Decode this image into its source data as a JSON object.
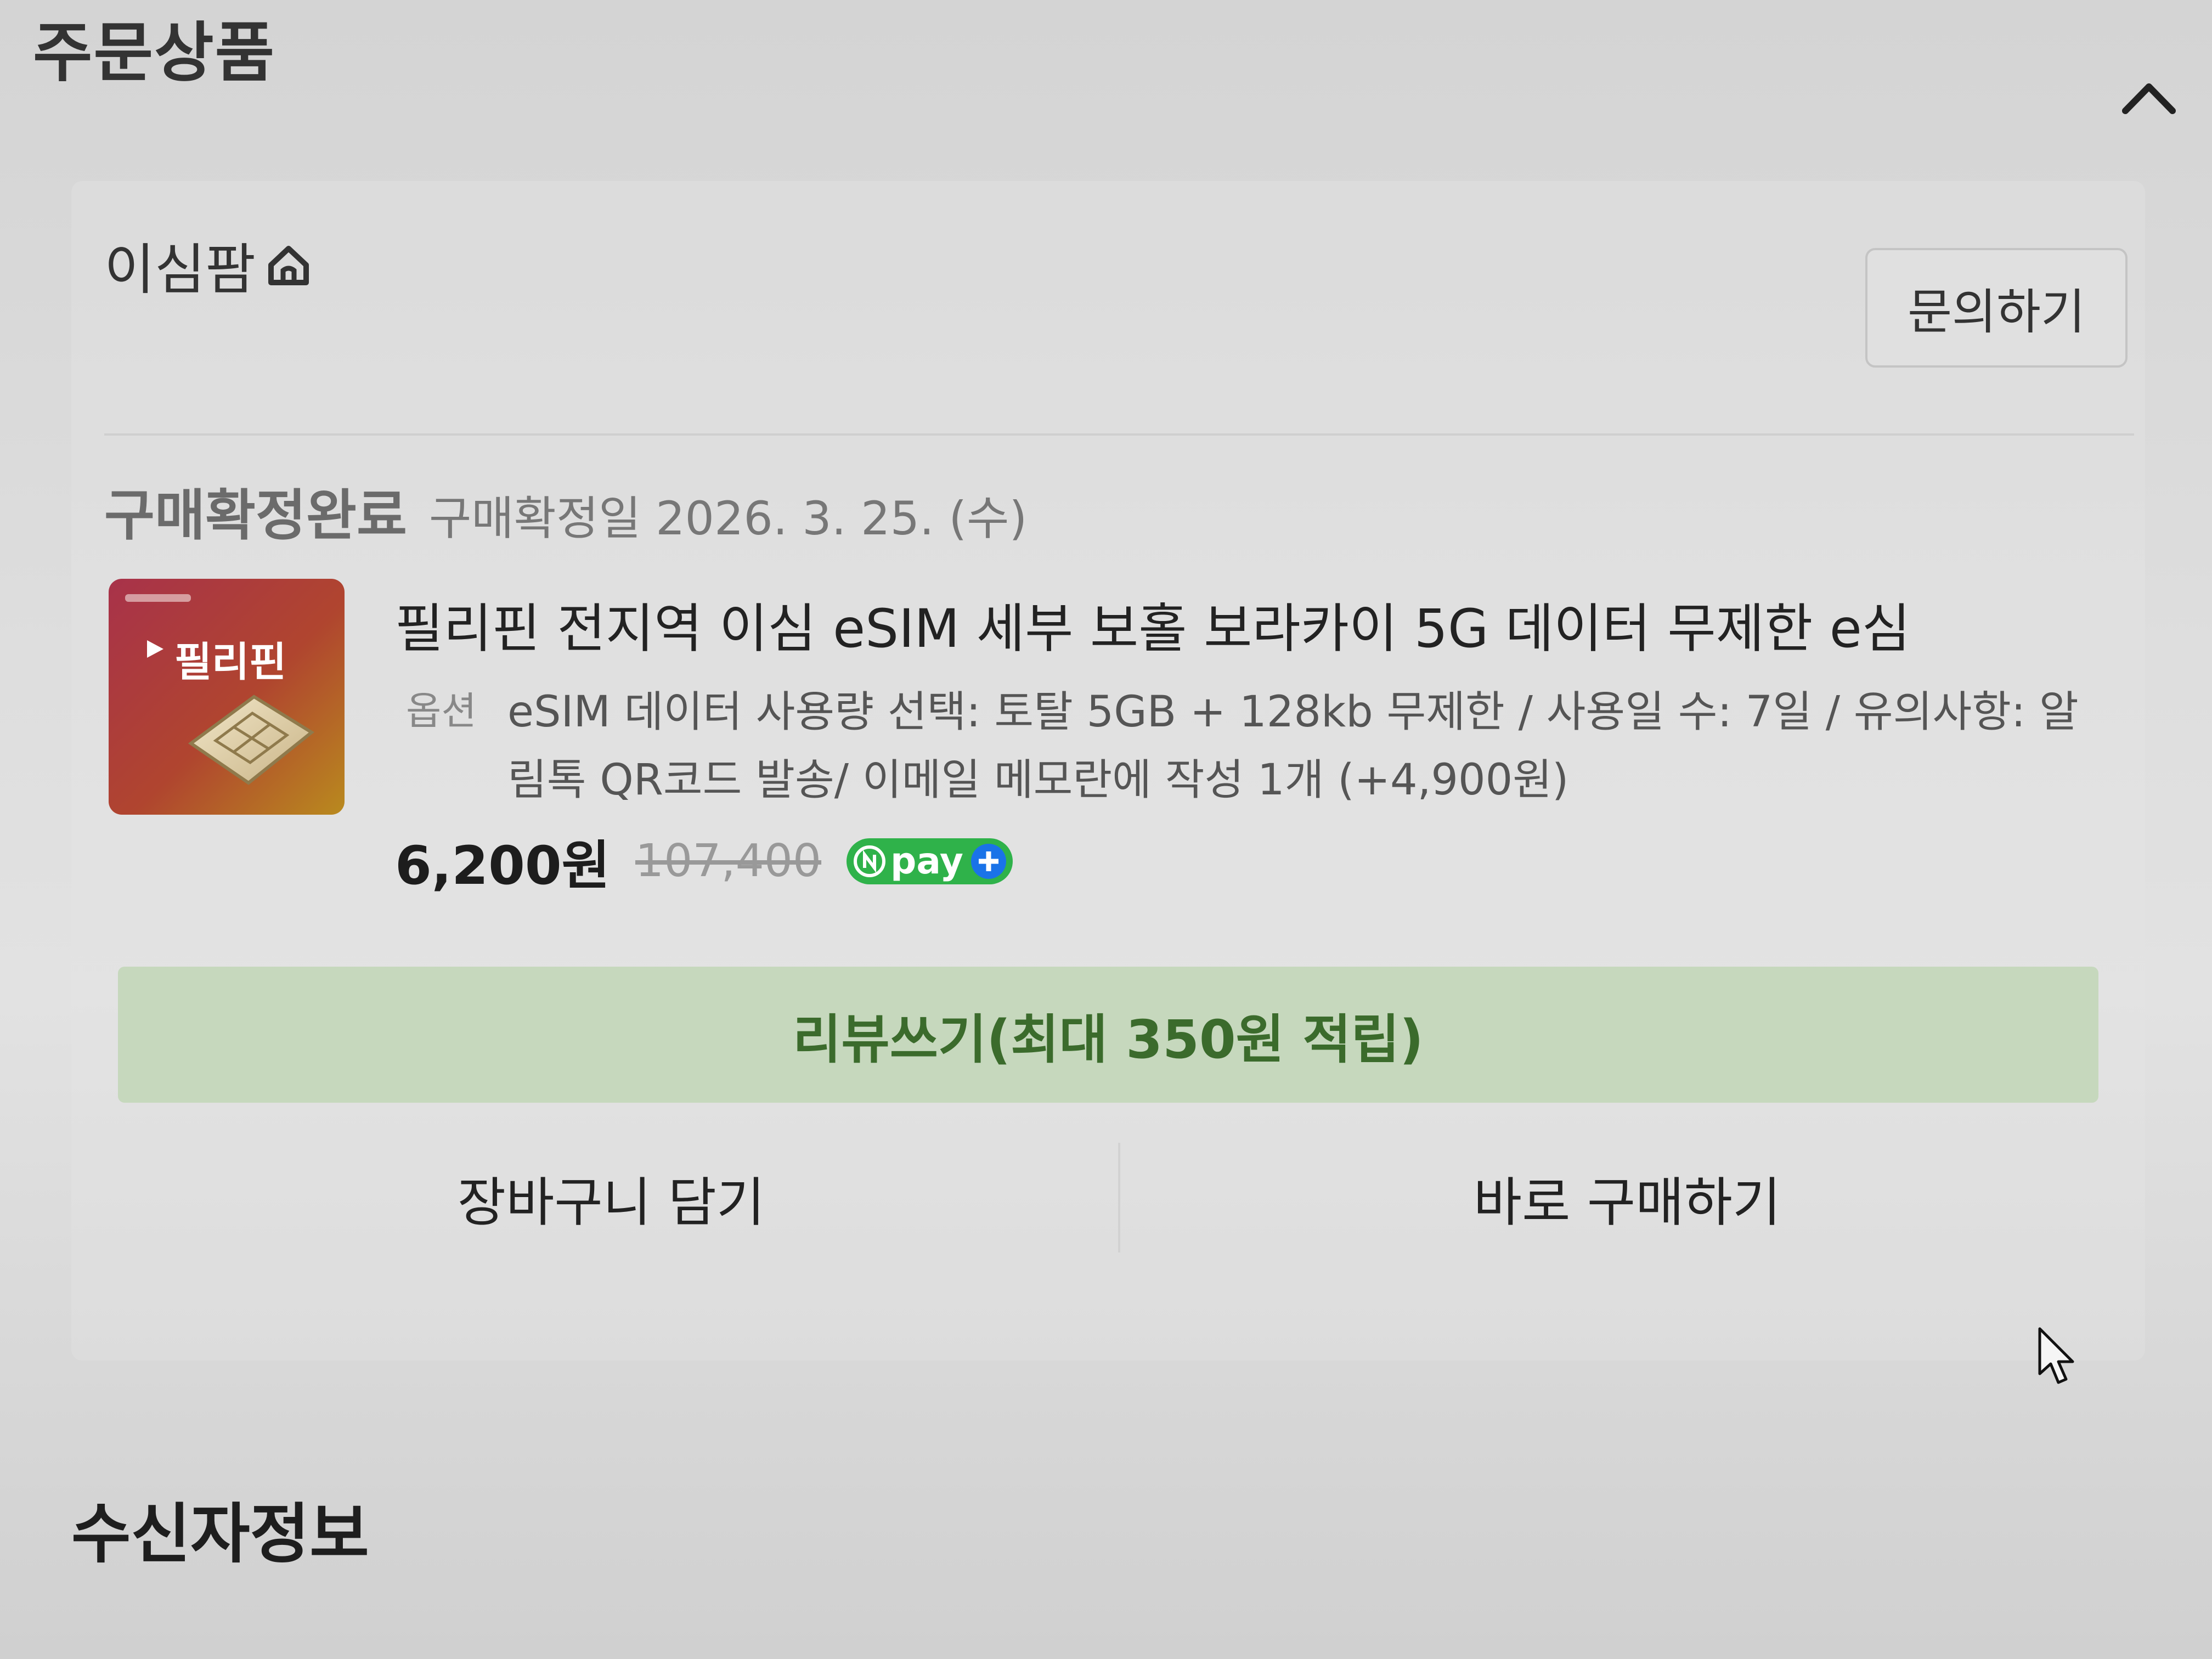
{
  "section": {
    "title": "주문상품",
    "collapse_icon": "chevron-up-icon"
  },
  "seller": {
    "name": "이심팜",
    "home_icon": "home-icon",
    "inquiry_label": "문의하기"
  },
  "order": {
    "status": "구매확정완료",
    "confirm_date": "구매확정일 2026. 3. 25. (수)",
    "thumbnail_text": "필리핀",
    "product_name": "필리핀 전지역 이심 eSIM 세부 보홀 보라카이 5G 데이터 무제한 e심",
    "option_label": "옵션",
    "option_text": "eSIM 데이터 사용량 선택: 토탈 5GB + 128kb 무제한 / 사용일 수: 7일 / 유의사항: 알림톡 QR코드 발송/ 이메일 메모란에 작성   1개 (+4,900원)",
    "price": "6,200원",
    "original_price": "107,400",
    "npay_label": "pay"
  },
  "actions": {
    "review_label": "리뷰쓰기(최대 350원 적립)",
    "cart_label": "장바구니 담기",
    "buy_label": "바로 구매하기"
  },
  "next_section": {
    "title": "수신자정보"
  },
  "colors": {
    "review_bg": "#c6d8bd",
    "review_text": "#3b6b2c",
    "npay_green": "#2fb24a",
    "npay_blue": "#1a73e8"
  }
}
